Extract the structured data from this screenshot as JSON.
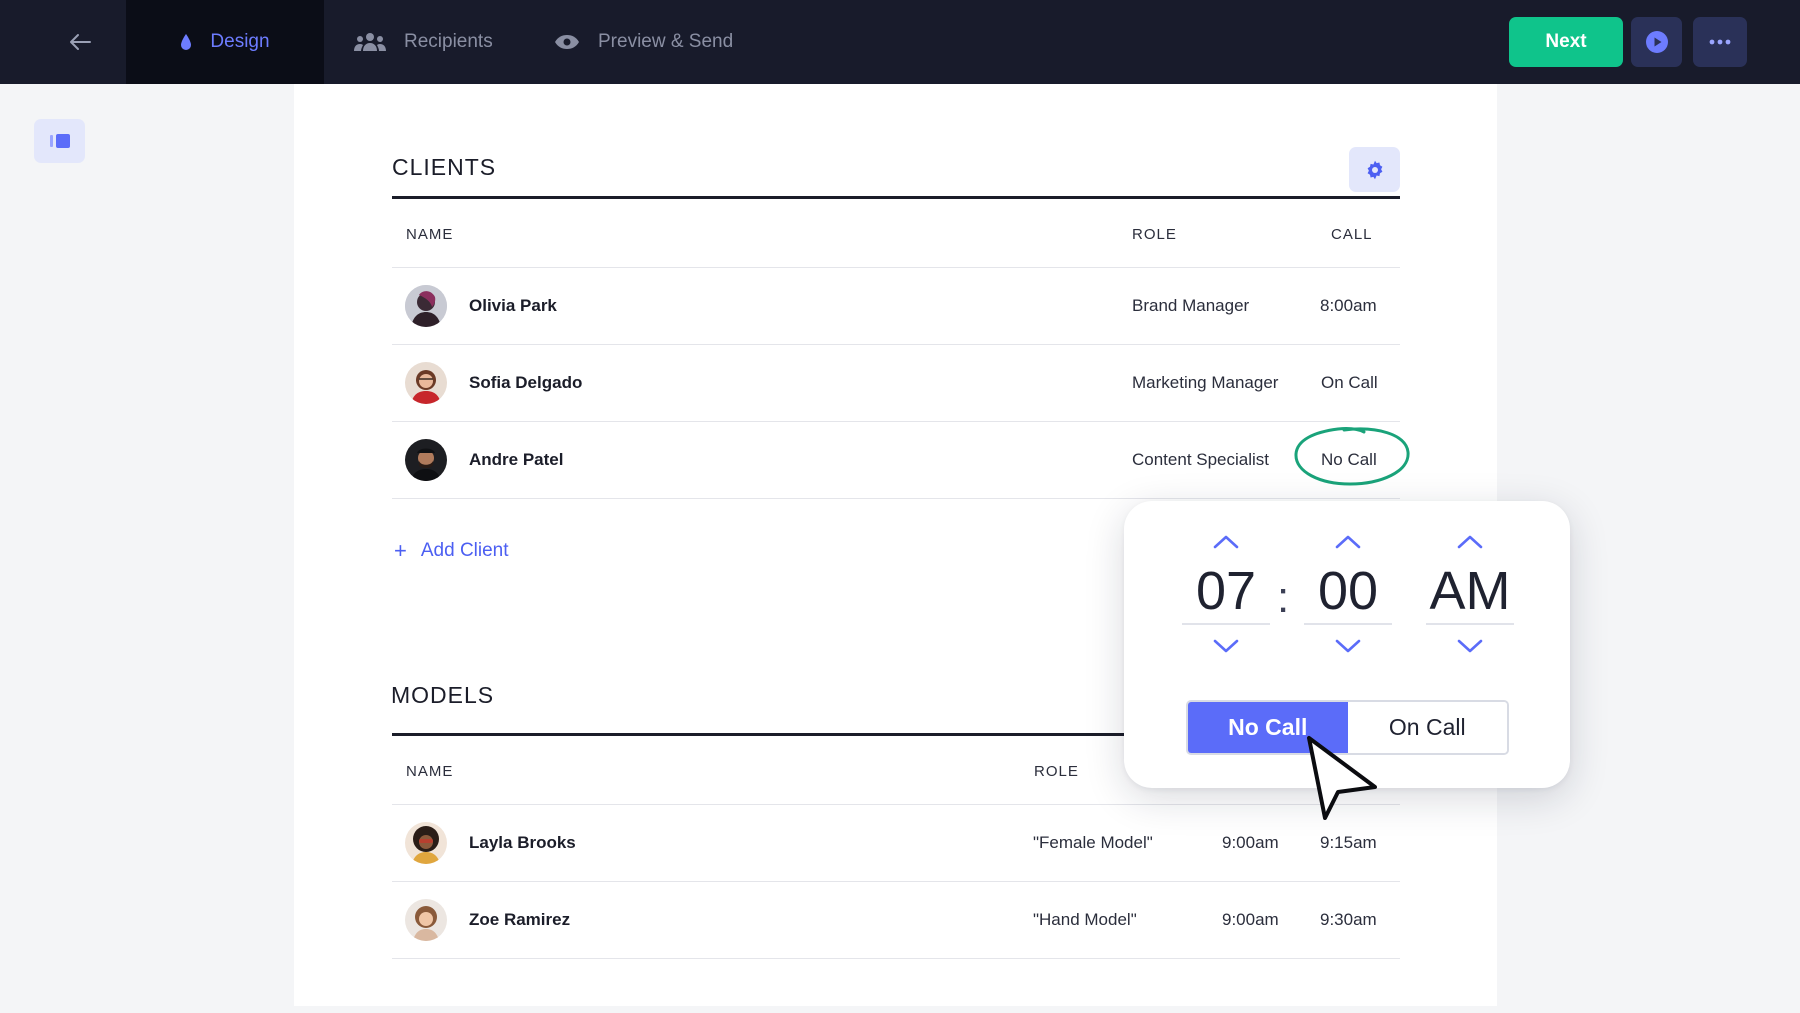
{
  "topbar": {
    "tabs": [
      {
        "label": "Design",
        "icon": "droplet-icon",
        "active": true
      },
      {
        "label": "Recipients",
        "icon": "people-icon"
      },
      {
        "label": "Preview & Send",
        "icon": "eye-icon"
      }
    ],
    "next_label": "Next"
  },
  "clients": {
    "title": "CLIENTS",
    "columns": {
      "name": "NAME",
      "role": "ROLE",
      "call": "CALL"
    },
    "rows": [
      {
        "name": "Olivia Park",
        "role": "Brand Manager",
        "call": "8:00am"
      },
      {
        "name": "Sofia Delgado",
        "role": "Marketing Manager",
        "call": "On Call"
      },
      {
        "name": "Andre Patel",
        "role": "Content Specialist",
        "call": "No Call"
      }
    ],
    "add_label": "Add Client"
  },
  "models": {
    "title": "MODELS",
    "columns": {
      "name": "NAME",
      "role": "ROLE"
    },
    "rows": [
      {
        "name": "Layla Brooks",
        "role": "\"Female Model\"",
        "time1": "9:00am",
        "time2": "9:15am"
      },
      {
        "name": "Zoe Ramirez",
        "role": "\"Hand Model\"",
        "time1": "9:00am",
        "time2": "9:30am"
      }
    ]
  },
  "picker": {
    "hour": "07",
    "minute": "00",
    "ampm": "AM",
    "separator": ":",
    "no_call_label": "No Call",
    "on_call_label": "On Call"
  },
  "colors": {
    "topbar": "#181b2b",
    "accent": "#5b6cf9",
    "next": "#0fc48b",
    "ring": "#1aa37a"
  }
}
